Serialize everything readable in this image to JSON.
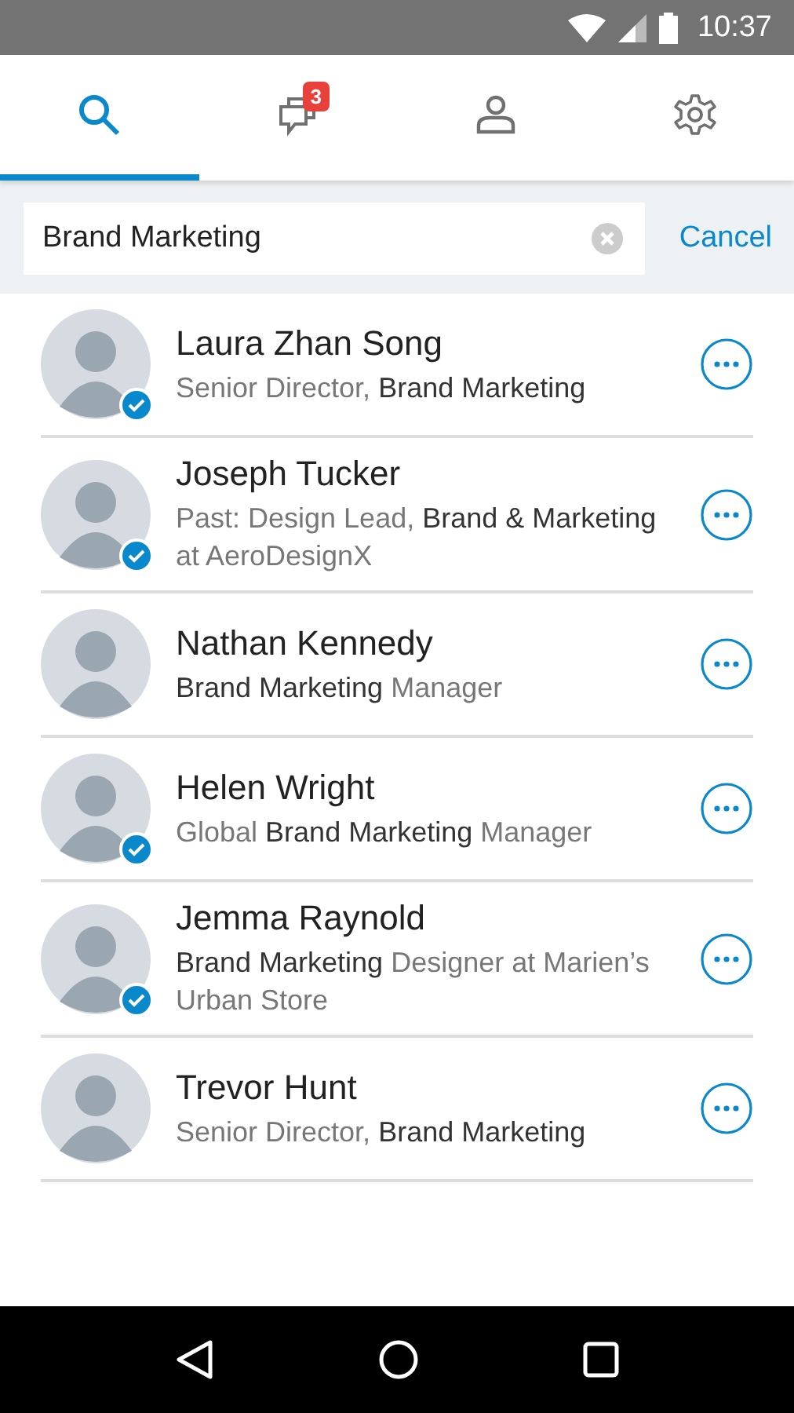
{
  "status_bar": {
    "time": "10:37"
  },
  "tabs": [
    {
      "kind": "search",
      "selected": true
    },
    {
      "kind": "messages",
      "selected": false,
      "badge": "3"
    },
    {
      "kind": "profile",
      "selected": false
    },
    {
      "kind": "settings",
      "selected": false
    }
  ],
  "search": {
    "value": "Brand Marketing",
    "cancel": "Cancel"
  },
  "results": [
    {
      "name": "Laura Zhan Song",
      "subtitle": "Senior Director, **Brand Marketing**",
      "verified": true
    },
    {
      "name": "Joseph Tucker",
      "subtitle": "Past: Design Lead, **Brand & Marketing** at AeroDesignX",
      "verified": true
    },
    {
      "name": "Nathan Kennedy",
      "subtitle": "**Brand Marketing** Manager",
      "verified": false
    },
    {
      "name": "Helen Wright",
      "subtitle": "Global **Brand Marketing** Manager",
      "verified": true
    },
    {
      "name": "Jemma Raynold",
      "subtitle": "**Brand Marketing** Designer at Marien’s Urban Store",
      "verified": true
    },
    {
      "name": "Trevor Hunt",
      "subtitle": "Senior Director, **Brand Marketing**",
      "verified": false
    }
  ]
}
